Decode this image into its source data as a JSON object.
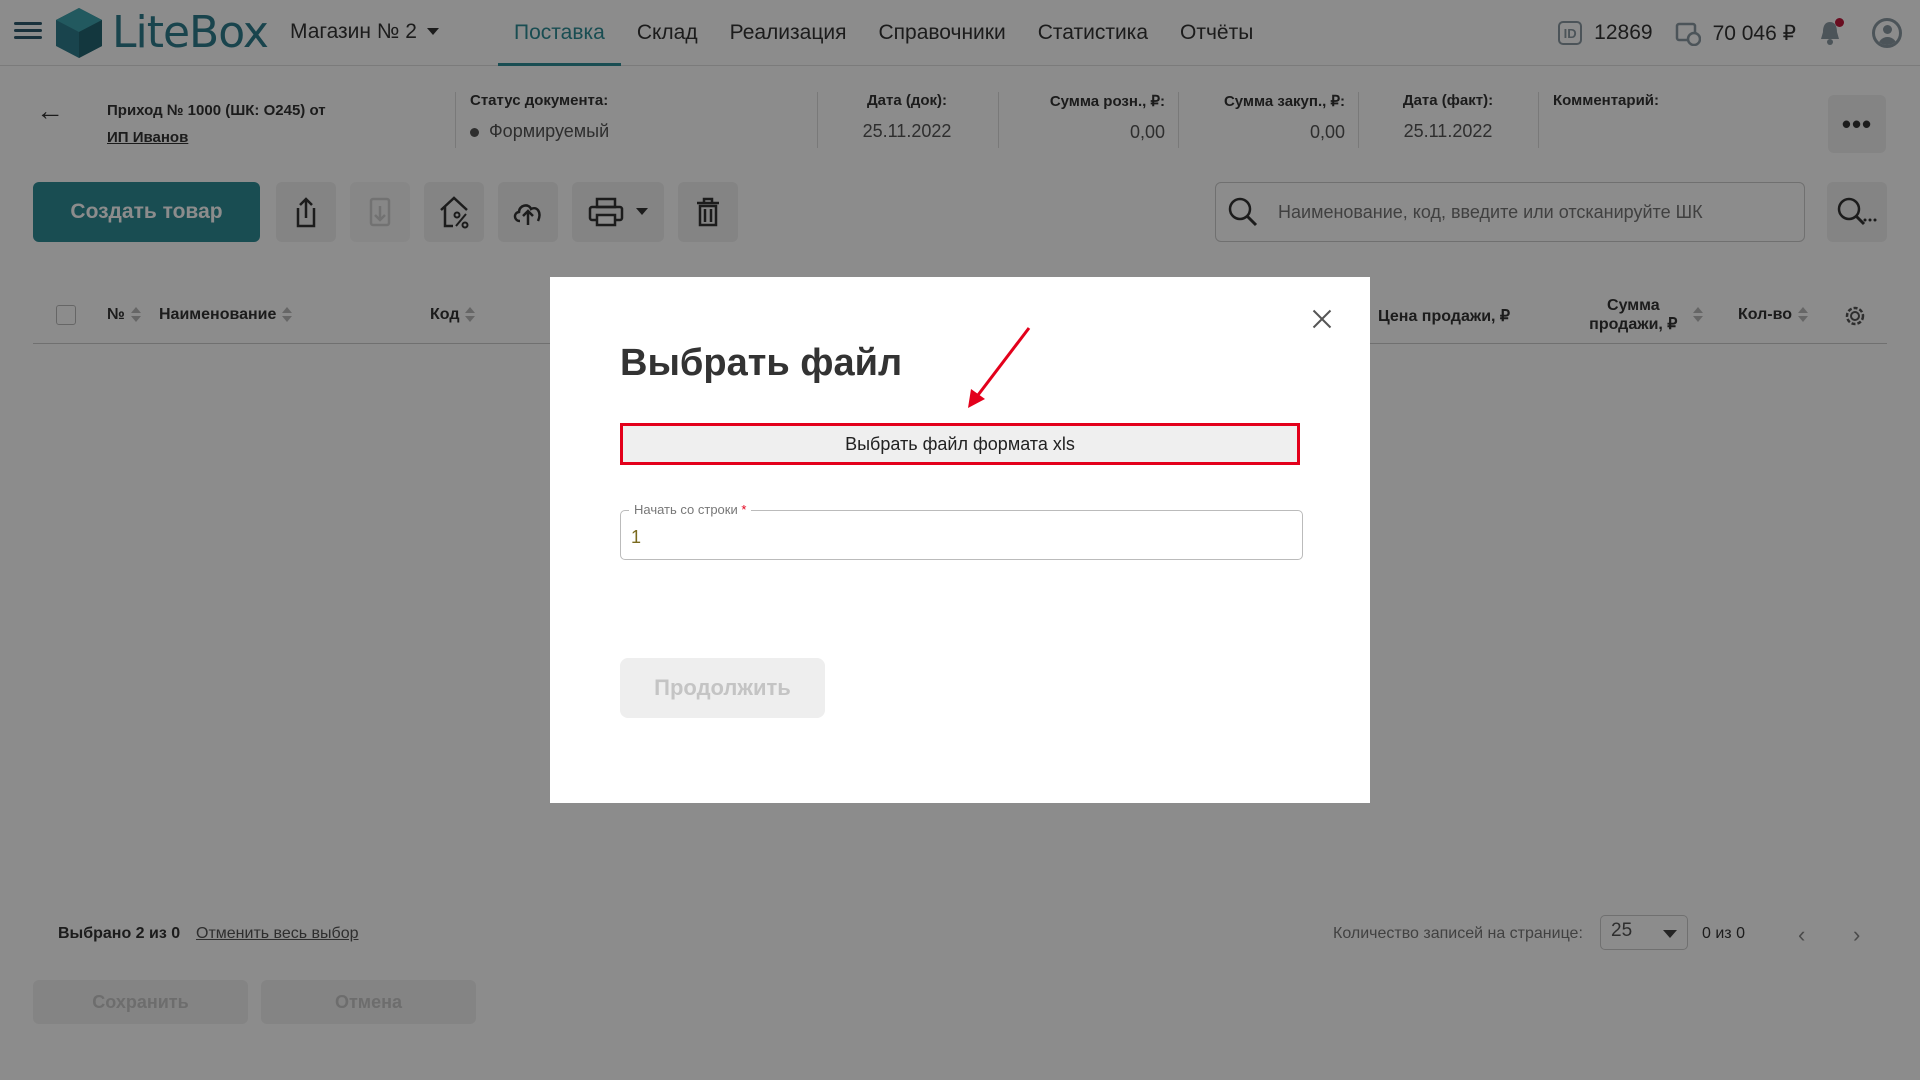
{
  "header": {
    "logo_text": "LiteBox",
    "store": "Магазин № 2",
    "nav": [
      {
        "label": "Поставка",
        "active": true
      },
      {
        "label": "Склад"
      },
      {
        "label": "Реализация"
      },
      {
        "label": "Справочники"
      },
      {
        "label": "Статистика"
      },
      {
        "label": "Отчёты"
      }
    ],
    "id_badge": "ID",
    "id_value": "12869",
    "balance": "70 046 ₽"
  },
  "document": {
    "title_prefix": "Приход № 1000 (ШК: О245) от",
    "supplier": "ИП Иванов",
    "status_label": "Статус документа:",
    "status_value": "Формируемый",
    "date_doc_label": "Дата (док):",
    "date_doc_value": "25.11.2022",
    "sum_retail_label": "Сумма розн., ₽:",
    "sum_retail_value": "0,00",
    "sum_purchase_label": "Сумма закуп., ₽:",
    "sum_purchase_value": "0,00",
    "date_fact_label": "Дата (факт):",
    "date_fact_value": "25.11.2022",
    "comment_label": "Комментарий:",
    "more": "•••"
  },
  "toolbar": {
    "create_label": "Создать товар",
    "search_placeholder": "Наименование, код, введите или отсканируйте ШК"
  },
  "table": {
    "columns": [
      "№",
      "Наименование",
      "Код",
      "Цена продажи, ₽",
      "Сумма продажи, ₽",
      "Кол-во"
    ]
  },
  "footer": {
    "selected_text": "Выбрано 2 из 0",
    "cancel_selection": "Отменить весь выбор",
    "per_page_label": "Количество записей на странице:",
    "per_page_value": "25",
    "range": "0 из 0",
    "prev": "‹",
    "next": "›",
    "save": "Сохранить",
    "cancel": "Отмена"
  },
  "modal": {
    "title": "Выбрать файл",
    "file_button": "Выбрать файл формата xls",
    "start_row_label": "Начать со строки",
    "required_mark": "*",
    "start_row_value": "1",
    "continue": "Продолжить"
  },
  "colors": {
    "accent": "#2f8c96",
    "highlight": "#e3001b"
  }
}
